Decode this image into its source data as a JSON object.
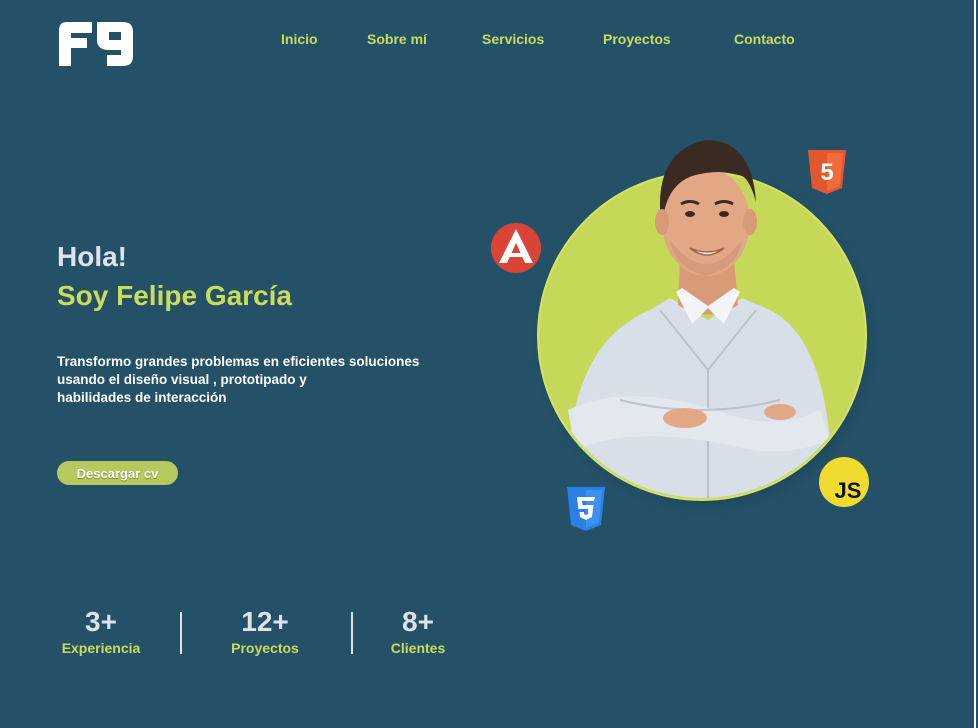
{
  "nav": {
    "items": [
      {
        "label": "Inicio"
      },
      {
        "label": "Sobre mí"
      },
      {
        "label": "Servicios"
      },
      {
        "label": "Proyectos"
      },
      {
        "label": "Contacto"
      }
    ]
  },
  "hero": {
    "greeting": "Hola!",
    "name": "Soy Felipe García",
    "description_lines": [
      "Transformo grandes problemas en eficientes soluciones",
      "usando el diseño visual , prototipado y",
      "habilidades de interacción"
    ],
    "cv_button": "Descargar cv"
  },
  "stats": [
    {
      "value": "3+",
      "label": "Experiencia"
    },
    {
      "value": "12+",
      "label": "Proyectos"
    },
    {
      "value": "8+",
      "label": "Clientes"
    }
  ],
  "badges": {
    "html": "5",
    "js": "JS"
  },
  "colors": {
    "background": "#245168",
    "accent": "#c9dd5a",
    "button": "#b6c95c",
    "circle": "#c6d857",
    "text_light": "#dde3e8"
  },
  "icons": [
    "logo-icon",
    "angular-icon",
    "html5-icon",
    "css3-icon",
    "javascript-icon"
  ]
}
